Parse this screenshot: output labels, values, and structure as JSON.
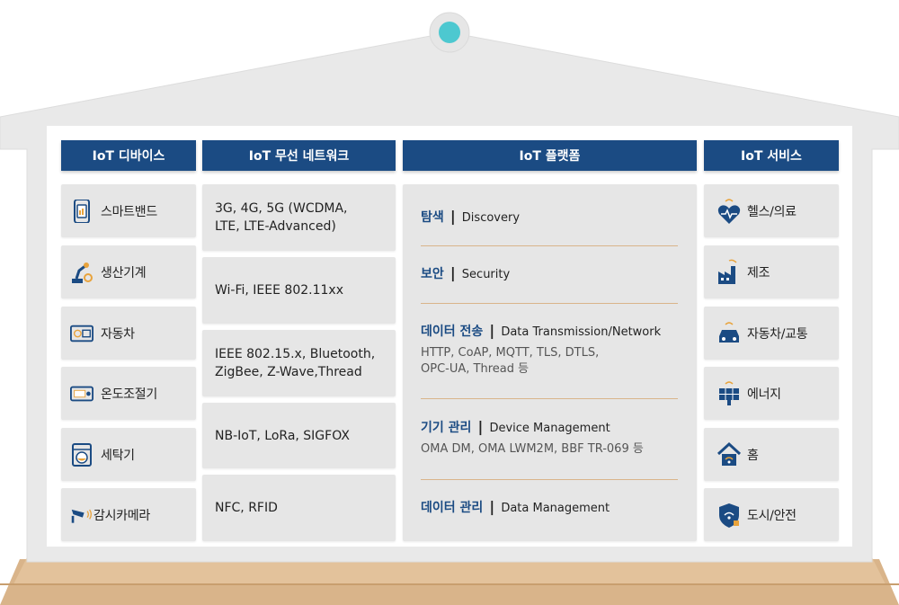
{
  "columns": {
    "devices": {
      "header": "IoT 디바이스",
      "items": [
        {
          "label": "스마트밴드",
          "icon": "smart-band-icon"
        },
        {
          "label": "생산기계",
          "icon": "robot-arm-icon"
        },
        {
          "label": "자동차",
          "icon": "car-dashboard-icon"
        },
        {
          "label": "온도조절기",
          "icon": "thermostat-icon"
        },
        {
          "label": "세탁기",
          "icon": "washing-machine-icon"
        },
        {
          "label": "감시카메라",
          "icon": "cctv-icon"
        }
      ]
    },
    "network": {
      "header": "IoT 무선 네트워크",
      "items": [
        {
          "line1": "3G, 4G, 5G (WCDMA,",
          "line2": "LTE, LTE-Advanced)"
        },
        {
          "line1": "Wi-Fi, IEEE 802.11xx",
          "line2": ""
        },
        {
          "line1": "IEEE 802.15.x, Bluetooth,",
          "line2": "ZigBee, Z-Wave,Thread"
        },
        {
          "line1": "NB-IoT, LoRa, SIGFOX",
          "line2": ""
        },
        {
          "line1": "NFC, RFID",
          "line2": ""
        }
      ]
    },
    "platform": {
      "header": "IoT 플랫폼",
      "items": [
        {
          "title": "탐색",
          "sep": "|",
          "en": "Discovery",
          "desc1": "",
          "desc2": ""
        },
        {
          "title": "보안",
          "sep": "|",
          "en": "Security",
          "desc1": "",
          "desc2": ""
        },
        {
          "title": "데이터 전송",
          "sep": "|",
          "en": "Data Transmission/Network",
          "desc1": "HTTP, CoAP, MQTT, TLS, DTLS,",
          "desc2": "OPC-UA, Thread 등"
        },
        {
          "title": "기기 관리",
          "sep": "|",
          "en": "Device Management",
          "desc1": "OMA DM, OMA LWM2M, BBF TR-069 등",
          "desc2": ""
        },
        {
          "title": "데이터 관리",
          "sep": "|",
          "en": "Data Management",
          "desc1": "",
          "desc2": ""
        }
      ]
    },
    "services": {
      "header": "IoT 서비스",
      "items": [
        {
          "label": "헬스/의료",
          "icon": "heart-health-icon"
        },
        {
          "label": "제조",
          "icon": "factory-icon"
        },
        {
          "label": "자동차/교통",
          "icon": "connected-car-icon"
        },
        {
          "label": "에너지",
          "icon": "solar-panel-icon"
        },
        {
          "label": "홈",
          "icon": "smart-home-icon"
        },
        {
          "label": "도시/안전",
          "icon": "security-shield-icon"
        }
      ]
    }
  },
  "colors": {
    "header_bg": "#1b4b83",
    "card_bg": "#e6e6e6",
    "house_frame": "#e8e8e8",
    "floor": "#d9b48a",
    "roof_knob": "#4dc8d0",
    "icon_blue": "#1b4b83",
    "icon_orange": "#e8a33c"
  }
}
